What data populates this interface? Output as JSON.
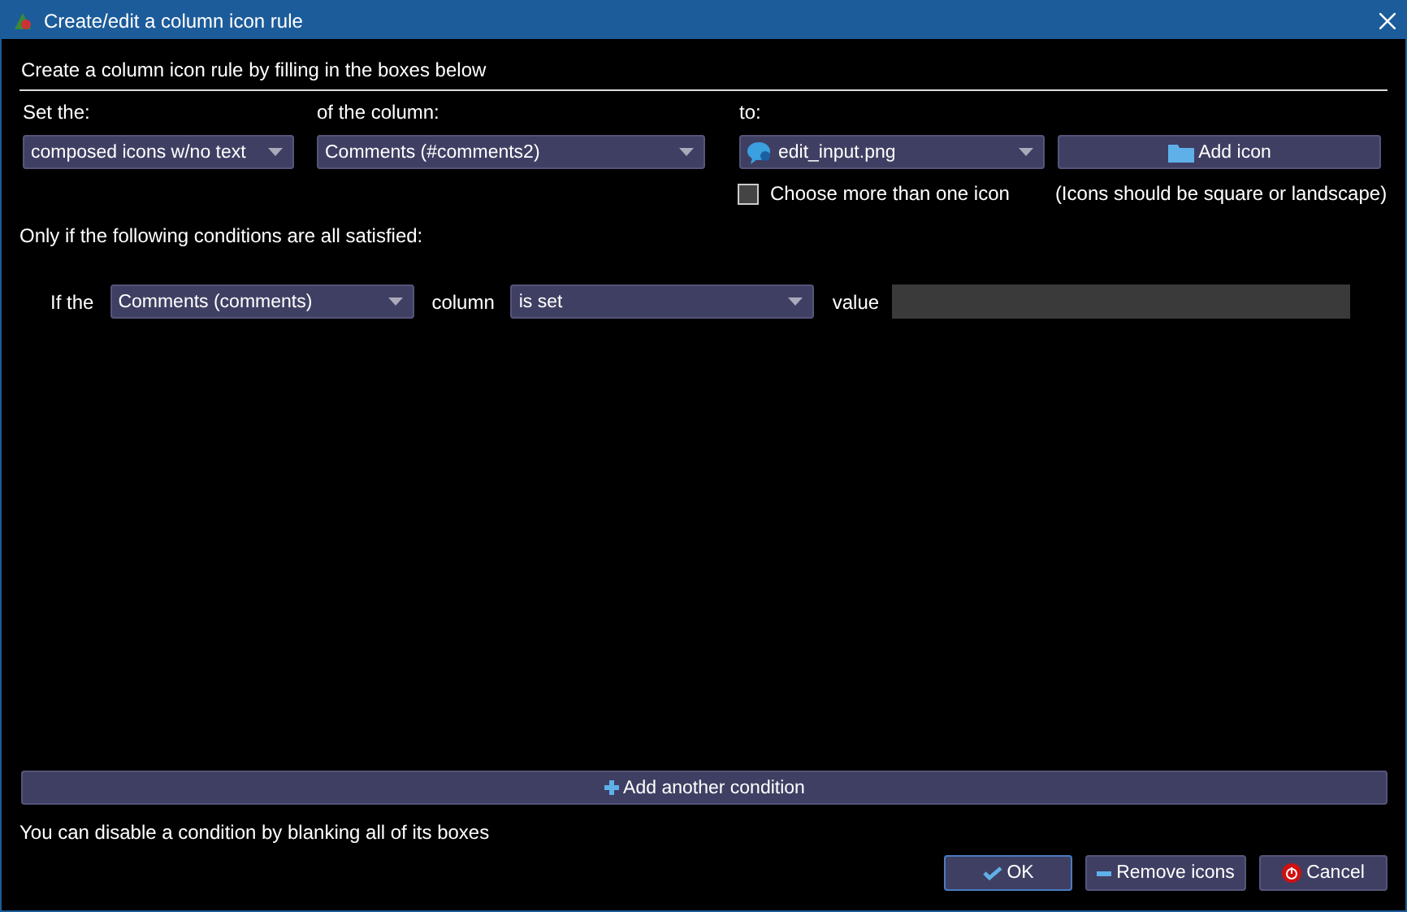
{
  "window": {
    "title": "Create/edit a column icon rule"
  },
  "heading": "Create a column icon rule by filling in the boxes below",
  "set_the": {
    "label": "Set the:",
    "value": "composed icons w/no text"
  },
  "of_the_column": {
    "label": "of the column:",
    "value": "Comments (#comments2)"
  },
  "to": {
    "label": "to:",
    "value": "edit_input.png"
  },
  "add_icon_button": "Add icon",
  "multiple_icons": {
    "label": "Choose more than one icon",
    "checked": false
  },
  "icon_hint": "(Icons should be square or landscape)",
  "conditions_label": "Only if the following conditions are all satisfied:",
  "conditions": [
    {
      "prefix": "If the",
      "column": "Comments (comments)",
      "middle": "column",
      "operator": "is set",
      "suffix": "value"
    }
  ],
  "add_condition_button": "Add another condition",
  "footer_hint": "You can disable a condition by blanking all of its boxes",
  "buttons": [
    {
      "kind": "ok",
      "label": "OK",
      "default": true
    },
    {
      "kind": "remove",
      "label": "Remove icons",
      "default": false
    },
    {
      "kind": "cancel",
      "label": "Cancel",
      "default": false
    }
  ]
}
